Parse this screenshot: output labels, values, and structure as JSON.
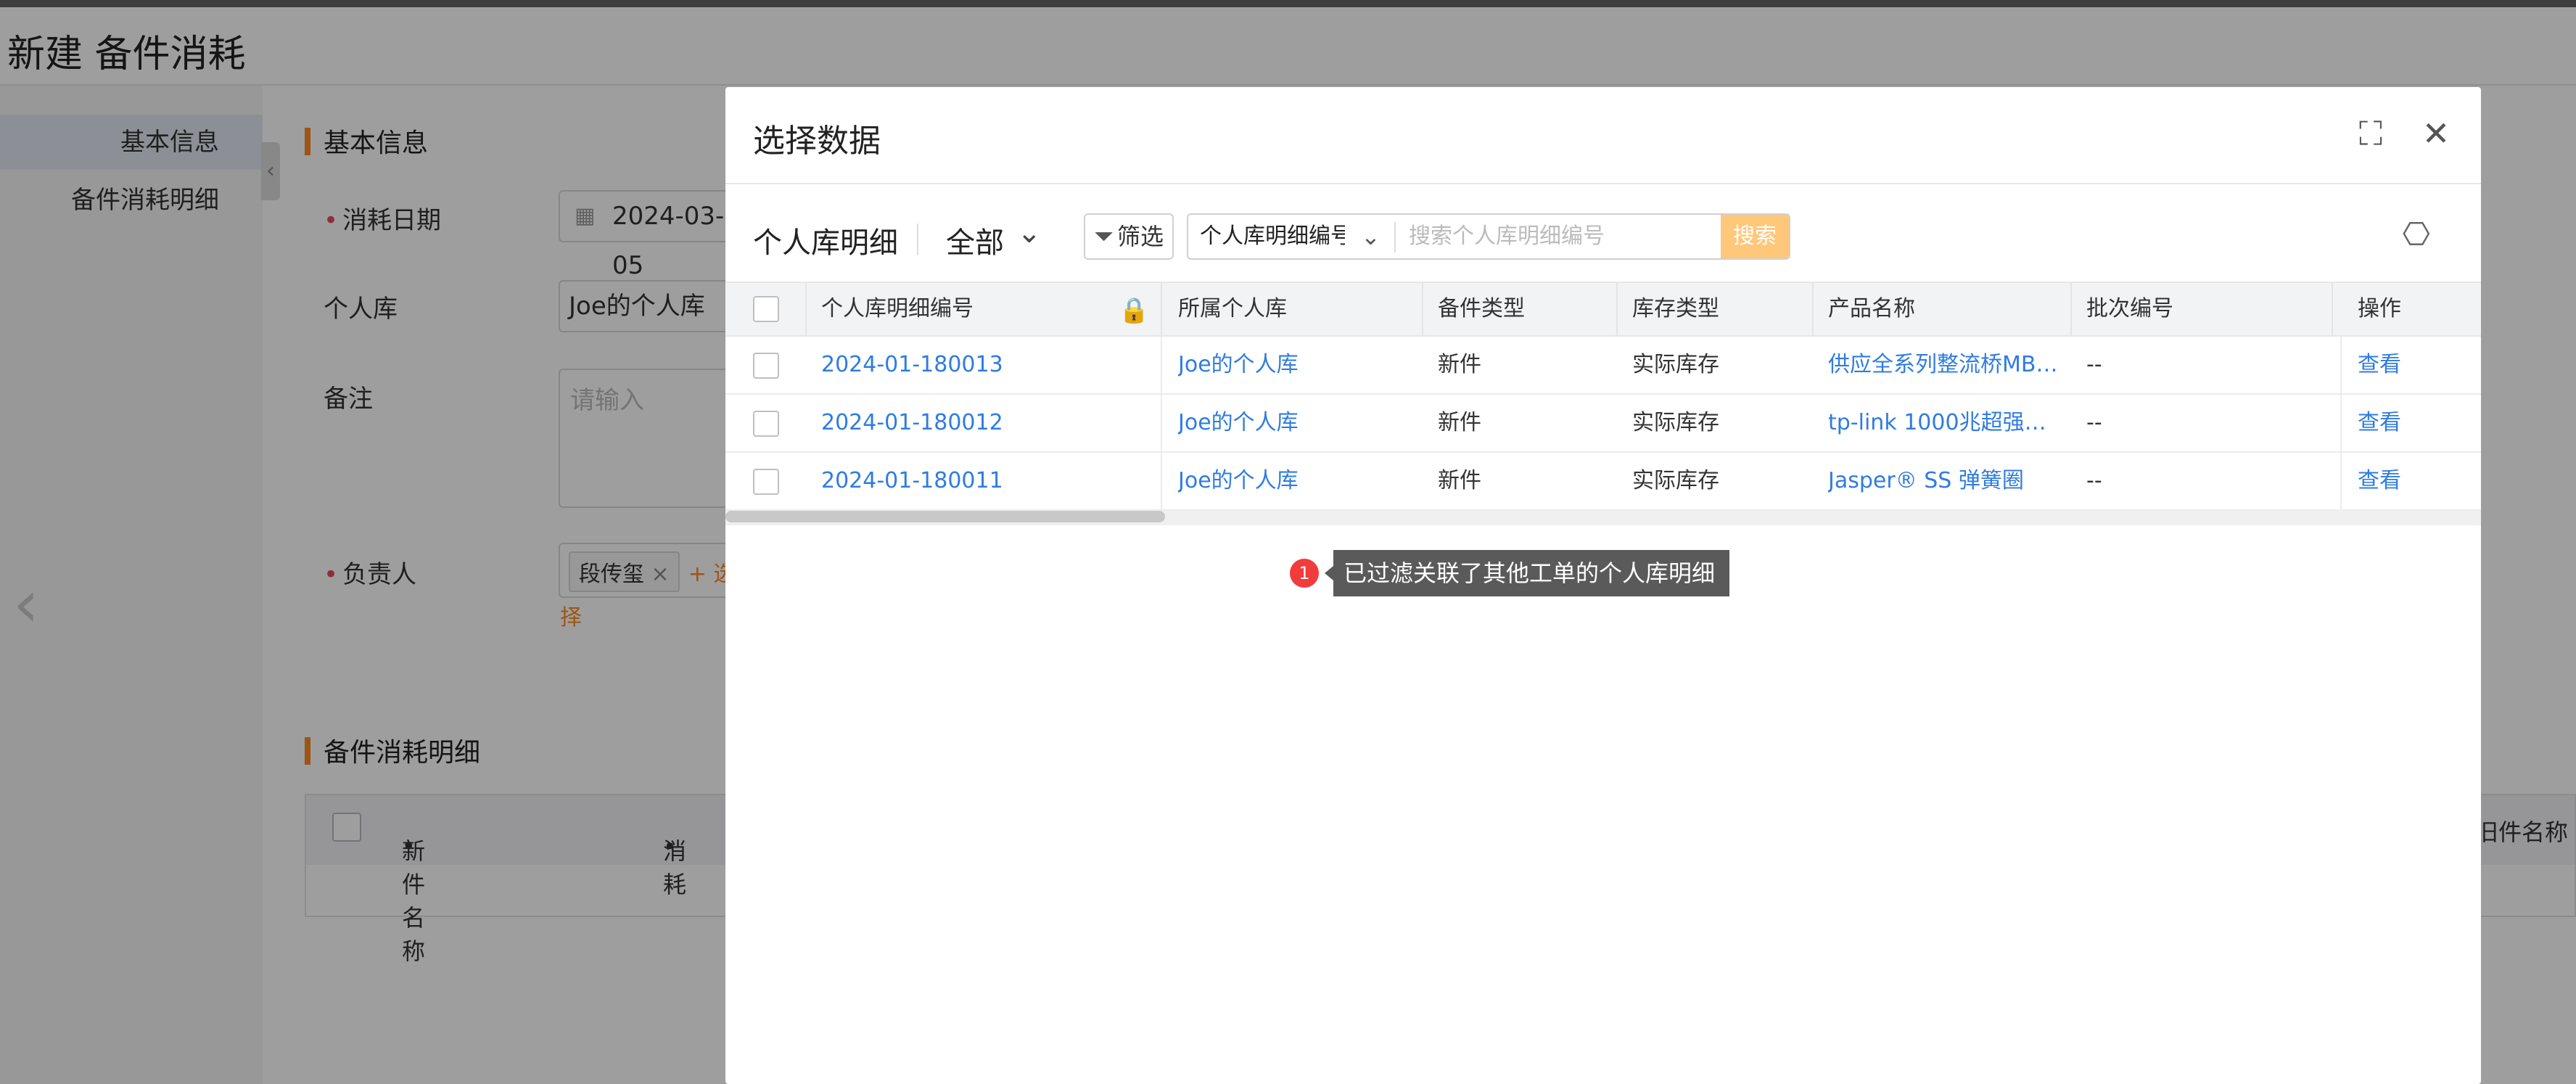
{
  "page": {
    "title": "新建 备件消耗"
  },
  "nav": {
    "items": [
      "基本信息",
      "备件消耗明细"
    ]
  },
  "form": {
    "section_basic": "基本信息",
    "date_label": "消耗日期",
    "date_value": "2024-03-05",
    "warehouse_label": "个人库",
    "warehouse_value": "Joe的个人库",
    "remark_label": "备注",
    "remark_placeholder": "请输入",
    "owner_label": "负责人",
    "owner_tag": "段传玺",
    "owner_add": "+ 选择",
    "section_detail": "备件消耗明细",
    "detail_headers": [
      "新件名称",
      "消耗",
      "旧件名称"
    ]
  },
  "modal": {
    "title": "选择数据",
    "toolbar": {
      "list_title": "个人库明细",
      "view": "全部",
      "filter_label": "筛选",
      "search_field": "个人库明细编号",
      "search_placeholder": "搜索个人库明细编号",
      "search_button": "搜索"
    },
    "table": {
      "headers": [
        "个人库明细编号",
        "所属个人库",
        "备件类型",
        "库存类型",
        "产品名称",
        "批次编号",
        "操作"
      ],
      "rows": [
        {
          "code": "2024-01-180013",
          "warehouse": "Joe的个人库",
          "part_type": "新件",
          "stock_type": "实际库存",
          "product": "供应全系列整流桥MB2…",
          "batch": "--",
          "action": "查看"
        },
        {
          "code": "2024-01-180012",
          "warehouse": "Joe的个人库",
          "part_type": "新件",
          "stock_type": "实际库存",
          "product": "tp-link 1000兆超强信…",
          "batch": "--",
          "action": "查看"
        },
        {
          "code": "2024-01-180011",
          "warehouse": "Joe的个人库",
          "part_type": "新件",
          "stock_type": "实际库存",
          "product": "Jasper® SS 弹簧圈",
          "batch": "--",
          "action": "查看"
        }
      ]
    },
    "notice": {
      "badge": "1",
      "text": "已过滤关联了其他工单的个人库明细"
    }
  },
  "icons": {
    "close": "close-icon",
    "fullscreen": "fullscreen-icon",
    "settings": "settings-icon",
    "lock": "lock-icon",
    "filter": "filter-icon"
  },
  "colors": {
    "accent": "#ff8a1f",
    "link": "#2f7ce0",
    "search_button": "#ffc77a",
    "badge": "#f23b3b"
  }
}
